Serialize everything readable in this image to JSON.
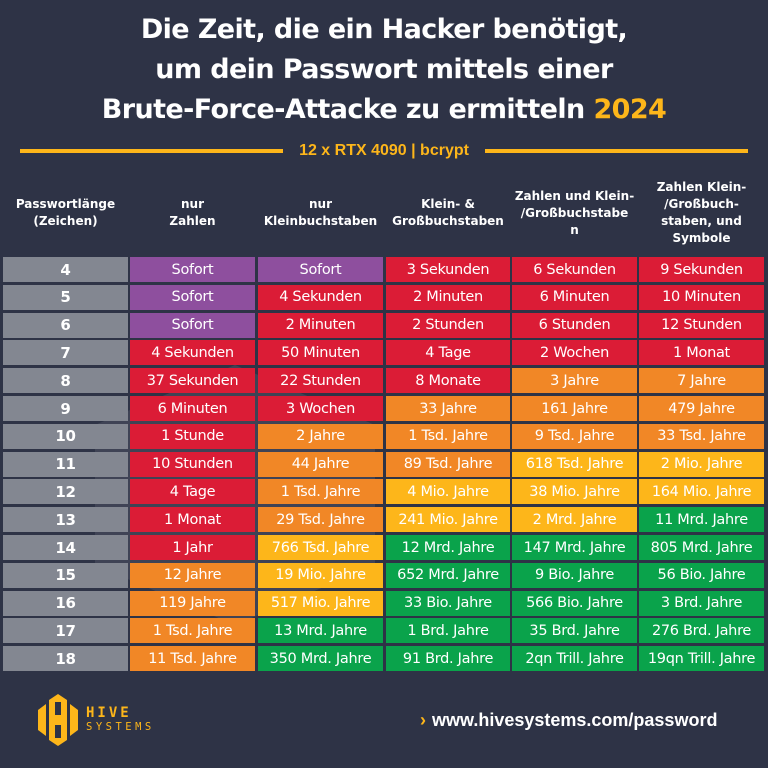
{
  "header": {
    "title_line1": "Die Zeit, die ein Hacker benötigt,",
    "title_line2": "um dein Passwort mittels einer",
    "title_line3": "Brute-Force-Attacke zu ermitteln",
    "title_year": "2024",
    "subtitle": "12 x RTX 4090 | bcrypt"
  },
  "colors": {
    "background": "#2e3346",
    "accent": "#fdb61a",
    "length_cell": "#838791",
    "instant": "#8e4f9e",
    "seconds_to_months": "#db1c36",
    "years_to_thousands": "#f18726",
    "millions_to_billions_de": "#fdb61a",
    "long": "#0aa34b"
  },
  "chart_data": {
    "type": "table",
    "title": "Die Zeit, die ein Hacker benötigt, um dein Passwort mittels einer Brute-Force-Attacke zu ermitteln 2024",
    "subtitle": "12 x RTX 4090 | bcrypt",
    "columns": [
      "Passwortlänge\n(Zeichen)",
      "nur\nZahlen",
      "nur\nKleinbuchstaben",
      "Klein- &\nGroßbuchstaben",
      "Zahlen und Klein-\n/Großbuchstabe\nn",
      "Zahlen Klein-\n/Großbuch-\nstaben, und\nSymbole"
    ],
    "rows": [
      {
        "length": "4",
        "values": [
          "Sofort",
          "Sofort",
          "3 Sekunden",
          "6 Sekunden",
          "9 Sekunden"
        ],
        "levels": [
          "instant",
          "instant",
          "seconds_to_months",
          "seconds_to_months",
          "seconds_to_months"
        ]
      },
      {
        "length": "5",
        "values": [
          "Sofort",
          "4 Sekunden",
          "2 Minuten",
          "6 Minuten",
          "10 Minuten"
        ],
        "levels": [
          "instant",
          "seconds_to_months",
          "seconds_to_months",
          "seconds_to_months",
          "seconds_to_months"
        ]
      },
      {
        "length": "6",
        "values": [
          "Sofort",
          "2 Minuten",
          "2 Stunden",
          "6 Stunden",
          "12 Stunden"
        ],
        "levels": [
          "instant",
          "seconds_to_months",
          "seconds_to_months",
          "seconds_to_months",
          "seconds_to_months"
        ]
      },
      {
        "length": "7",
        "values": [
          "4 Sekunden",
          "50 Minuten",
          "4 Tage",
          "2 Wochen",
          "1 Monat"
        ],
        "levels": [
          "seconds_to_months",
          "seconds_to_months",
          "seconds_to_months",
          "seconds_to_months",
          "seconds_to_months"
        ]
      },
      {
        "length": "8",
        "values": [
          "37 Sekunden",
          "22 Stunden",
          "8 Monate",
          "3 Jahre",
          "7 Jahre"
        ],
        "levels": [
          "seconds_to_months",
          "seconds_to_months",
          "seconds_to_months",
          "years_to_thousands",
          "years_to_thousands"
        ]
      },
      {
        "length": "9",
        "values": [
          "6 Minuten",
          "3 Wochen",
          "33 Jahre",
          "161 Jahre",
          "479 Jahre"
        ],
        "levels": [
          "seconds_to_months",
          "seconds_to_months",
          "years_to_thousands",
          "years_to_thousands",
          "years_to_thousands"
        ]
      },
      {
        "length": "10",
        "values": [
          "1 Stunde",
          "2 Jahre",
          "1 Tsd. Jahre",
          "9 Tsd. Jahre",
          "33 Tsd. Jahre"
        ],
        "levels": [
          "seconds_to_months",
          "years_to_thousands",
          "years_to_thousands",
          "years_to_thousands",
          "years_to_thousands"
        ]
      },
      {
        "length": "11",
        "values": [
          "10 Stunden",
          "44 Jahre",
          "89 Tsd. Jahre",
          "618 Tsd. Jahre",
          "2 Mio. Jahre"
        ],
        "levels": [
          "seconds_to_months",
          "years_to_thousands",
          "years_to_thousands",
          "millions_to_billions_de",
          "millions_to_billions_de"
        ]
      },
      {
        "length": "12",
        "values": [
          "4 Tage",
          "1 Tsd. Jahre",
          "4 Mio. Jahre",
          "38 Mio. Jahre",
          "164 Mio. Jahre"
        ],
        "levels": [
          "seconds_to_months",
          "years_to_thousands",
          "millions_to_billions_de",
          "millions_to_billions_de",
          "millions_to_billions_de"
        ]
      },
      {
        "length": "13",
        "values": [
          "1 Monat",
          "29 Tsd. Jahre",
          "241 Mio. Jahre",
          "2 Mrd. Jahre",
          "11 Mrd. Jahre"
        ],
        "levels": [
          "seconds_to_months",
          "years_to_thousands",
          "millions_to_billions_de",
          "millions_to_billions_de",
          "long"
        ]
      },
      {
        "length": "14",
        "values": [
          "1 Jahr",
          "766 Tsd. Jahre",
          "12 Mrd. Jahre",
          "147 Mrd. Jahre",
          "805 Mrd. Jahre"
        ],
        "levels": [
          "seconds_to_months",
          "millions_to_billions_de",
          "long",
          "long",
          "long"
        ]
      },
      {
        "length": "15",
        "values": [
          "12 Jahre",
          "19 Mio. Jahre",
          "652 Mrd. Jahre",
          "9 Bio. Jahre",
          "56 Bio. Jahre"
        ],
        "levels": [
          "years_to_thousands",
          "millions_to_billions_de",
          "long",
          "long",
          "long"
        ]
      },
      {
        "length": "16",
        "values": [
          "119 Jahre",
          "517 Mio. Jahre",
          "33 Bio. Jahre",
          "566 Bio. Jahre",
          "3 Brd. Jahre"
        ],
        "levels": [
          "years_to_thousands",
          "millions_to_billions_de",
          "long",
          "long",
          "long"
        ]
      },
      {
        "length": "17",
        "values": [
          "1 Tsd. Jahre",
          "13 Mrd. Jahre",
          "1 Brd. Jahre",
          "35 Brd. Jahre",
          "276 Brd. Jahre"
        ],
        "levels": [
          "years_to_thousands",
          "long",
          "long",
          "long",
          "long"
        ]
      },
      {
        "length": "18",
        "values": [
          "11 Tsd. Jahre",
          "350 Mrd. Jahre",
          "91 Brd. Jahre",
          "2qn Trill. Jahre",
          "19qn Trill. Jahre"
        ],
        "levels": [
          "years_to_thousands",
          "long",
          "long",
          "long",
          "long"
        ]
      }
    ]
  },
  "footer": {
    "logo_line1": "HIVE",
    "logo_line2": "SYSTEMS",
    "url_chevron_icon": "chevron-right-icon",
    "url": "www.hivesystems.com/password"
  }
}
